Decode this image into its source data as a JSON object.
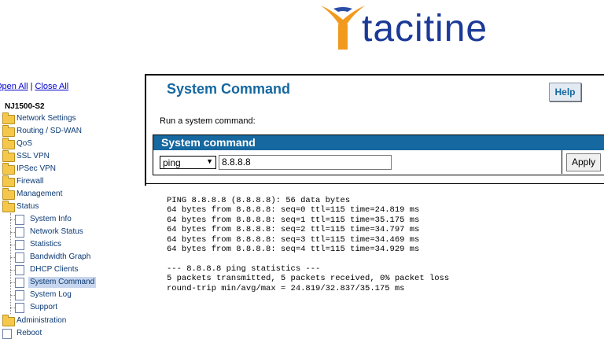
{
  "logo": {
    "text": "tacitine",
    "mark_color": "#f29a1e",
    "text_color": "#1b3a97"
  },
  "tree": {
    "open_all": "Open All",
    "separator": "|",
    "close_all": "Close All",
    "root": "NJ1500-S2",
    "folders": [
      "Network Settings",
      "Routing / SD-WAN",
      "QoS",
      "SSL VPN",
      "IPSec VPN",
      "Firewall",
      "Management",
      "Status"
    ],
    "status_children": [
      "System Info",
      "Network Status",
      "Statistics",
      "Bandwidth Graph",
      "DHCP Clients",
      "System Command",
      "System Log",
      "Support"
    ],
    "after": [
      "Administration",
      "Reboot"
    ],
    "selected": "System Command"
  },
  "main": {
    "title": "System Command",
    "help_label": "Help",
    "description": "Run a system command:",
    "section_header": "System command",
    "command_select": "ping",
    "target_value": "8.8.8.8",
    "apply_label": "Apply"
  },
  "output": {
    "lines": [
      "PING 8.8.8.8 (8.8.8.8): 56 data bytes",
      "64 bytes from 8.8.8.8: seq=0 ttl=115 time=24.819 ms",
      "64 bytes from 8.8.8.8: seq=1 ttl=115 time=35.175 ms",
      "64 bytes from 8.8.8.8: seq=2 ttl=115 time=34.797 ms",
      "64 bytes from 8.8.8.8: seq=3 ttl=115 time=34.469 ms",
      "64 bytes from 8.8.8.8: seq=4 ttl=115 time=34.929 ms",
      "",
      "--- 8.8.8.8 ping statistics ---",
      "5 packets transmitted, 5 packets received, 0% packet loss",
      "round-trip min/avg/max = 24.819/32.837/35.175 ms"
    ]
  },
  "colors": {
    "accent": "#1568a0",
    "folder": "#f5c84c",
    "selected_bg": "#c7d6ee"
  }
}
